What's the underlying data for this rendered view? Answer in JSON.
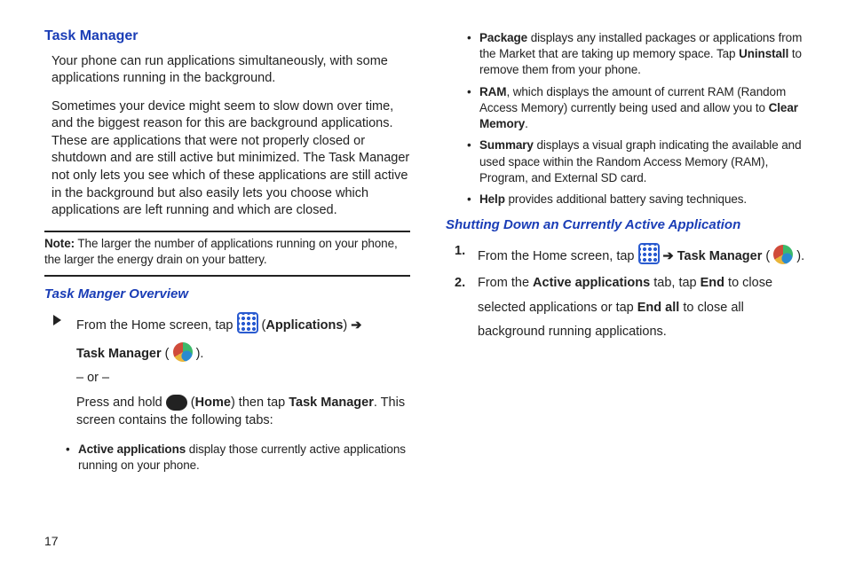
{
  "page_number": "17",
  "left": {
    "title": "Task Manager",
    "p1": "Your phone can run applications simultaneously, with some applications running in the background.",
    "p2": "Sometimes your device might seem to slow down over time, and the biggest reason for this are background applications. These are applications that were not properly closed or shutdown and are still active but minimized. The Task Manager not only lets you see which of these applications are still active in the background but also easily lets you choose which applications are left running and which are closed.",
    "note_label": "Note:",
    "note": " The larger the number of applications running on your phone, the larger the energy drain on your battery.",
    "subtitle": "Task Manger Overview",
    "step1a_pre": "From the Home screen, tap ",
    "step1a_apps_open": " (",
    "step1a_apps": "Applications",
    "step1a_apps_close": ") ",
    "step1a_arrow": "➔",
    "step1b_tm": "Task Manager",
    "step1b_open": " (",
    "step1b_close": ").",
    "or": "– or –",
    "step1c_pre": "Press and hold ",
    "step1c_home_open": " (",
    "step1c_home": "Home",
    "step1c_home_close": ") then tap ",
    "step1c_tm": "Task Manager",
    "step1c_tail": ". This screen contains the following tabs:",
    "b1_label": "Active applications",
    "b1_rest": " display those currently active applications running on your phone."
  },
  "right": {
    "b_package_label": "Package",
    "b_package_rest": " displays any installed packages or applications from the Market that are taking up memory space. Tap ",
    "b_package_uninstall": "Uninstall",
    "b_package_tail": " to remove them from your phone.",
    "b_ram_label": "RAM",
    "b_ram_rest": ", which displays the amount of current RAM (Random Access Memory) currently being used and allow you to ",
    "b_ram_clear": "Clear Memory",
    "b_ram_tail": ".",
    "b_summary_label": "Summary",
    "b_summary_rest": " displays a visual graph indicating the available and used space within the Random Access Memory (RAM), Program, and External SD card.",
    "b_help_label": "Help",
    "b_help_rest": " provides additional battery saving techniques.",
    "subtitle": "Shutting Down an Currently Active Application",
    "s1_num": "1.",
    "s1_pre": "From the Home screen, tap ",
    "s1_arrow": " ➔",
    "s1_tm": "Task Manager",
    "s1_open": " (",
    "s1_close": ").",
    "s2_num": "2.",
    "s2_pre": "From the ",
    "s2_tab": "Active applications",
    "s2_mid": " tab, tap ",
    "s2_end": "End",
    "s2_mid2": " to close selected applications or tap ",
    "s2_endall": "End all",
    "s2_tail": " to close all background running applications."
  }
}
